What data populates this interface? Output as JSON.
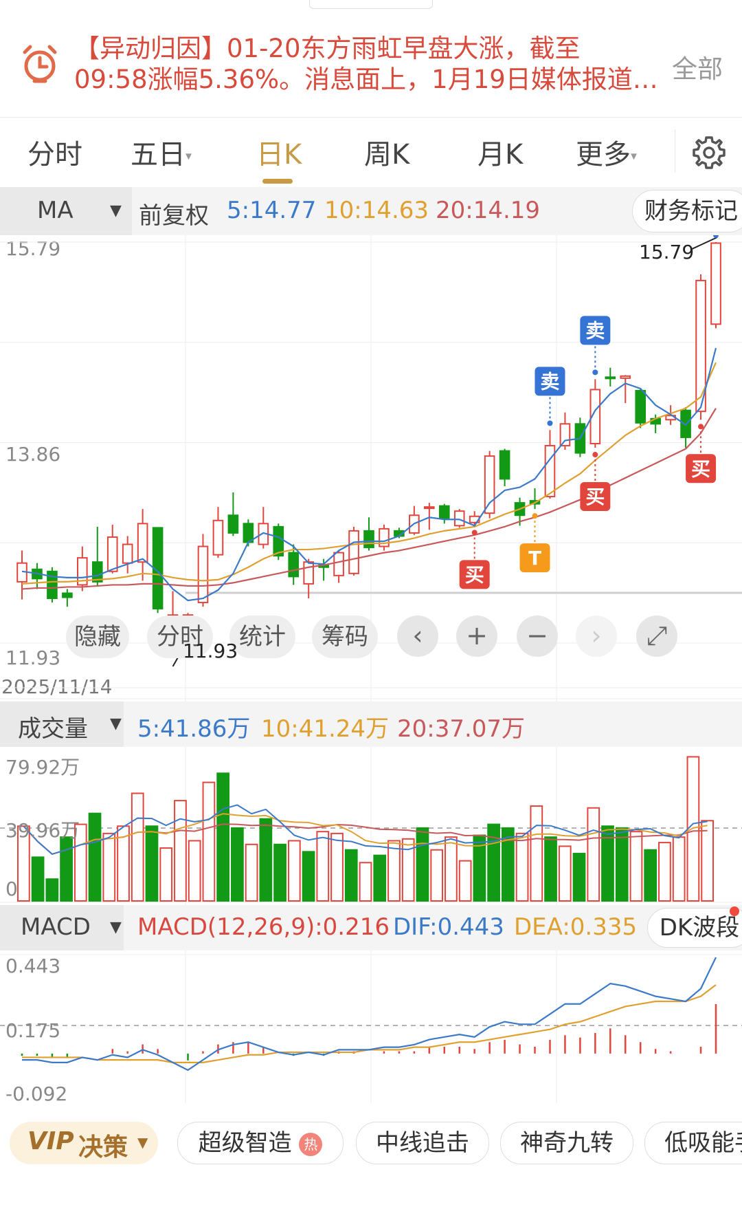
{
  "alert": {
    "line1": "【异动归因】01-20东方雨虹早盘大涨，截至",
    "line2": "09:58涨幅5.36%。消息面上，1月19日媒体报道…",
    "all_label": "全部",
    "icon": "alarm-clock-icon"
  },
  "tabs": [
    "分时",
    "五日",
    "日K",
    "周K",
    "月K",
    "更多"
  ],
  "tab_active": "日K",
  "ma_row": {
    "selector": "MA",
    "adjust": "前复权",
    "ma5": "5:14.77",
    "ma10": "10:14.63",
    "ma20": "20:14.19",
    "finance_btn": "财务标记"
  },
  "price_axis": {
    "top": "15.79",
    "mid": "13.86",
    "bottom": "11.93",
    "date": "2025/11/14"
  },
  "annotations": {
    "high": "15.79",
    "low": "11.93"
  },
  "signals": {
    "sell": "卖",
    "buy": "买",
    "t": "T"
  },
  "chart_controls": {
    "hide": "隐藏",
    "intraday": "分时",
    "stats": "统计",
    "chips": "筹码"
  },
  "volume_row": {
    "selector": "成交量",
    "ma5": "5:41.86万",
    "ma10": "10:41.24万",
    "ma20": "20:37.07万",
    "axis_top": "79.92万",
    "axis_mid": "39.96万",
    "axis_zero": "0"
  },
  "macd_row": {
    "selector": "MACD",
    "macd": "MACD(12,26,9):0.216",
    "dif": "DIF:0.443",
    "dea": "DEA:0.335",
    "dk_btn": "DK波段",
    "axis_top": "0.443",
    "axis_mid": "0.175",
    "axis_bottom": "-0.092"
  },
  "bottom": {
    "vip": "VIP",
    "vip_label": "决策",
    "items": [
      "超级智造",
      "中线追击",
      "神奇九转",
      "低吸能手"
    ],
    "hot_badge": "热"
  },
  "colors": {
    "up": "#e2453c",
    "down": "#129a16",
    "ma5": "#3b79c9",
    "ma10": "#e0a030",
    "ma20": "#c8585a",
    "accent": "#c99a44"
  },
  "chart_data": {
    "type": "candlestick",
    "start_date": "2025/11/14",
    "ylim": [
      11.93,
      15.79
    ],
    "candles": [
      {
        "o": 12.52,
        "c": 12.7,
        "h": 12.82,
        "l": 12.35,
        "up": true
      },
      {
        "o": 12.64,
        "c": 12.55,
        "h": 12.7,
        "l": 12.45,
        "up": false
      },
      {
        "o": 12.62,
        "c": 12.36,
        "h": 12.66,
        "l": 12.32,
        "up": false
      },
      {
        "o": 12.41,
        "c": 12.37,
        "h": 12.45,
        "l": 12.28,
        "up": false
      },
      {
        "o": 12.49,
        "c": 12.75,
        "h": 12.86,
        "l": 12.43,
        "up": true
      },
      {
        "o": 12.71,
        "c": 12.52,
        "h": 13.05,
        "l": 12.48,
        "up": false
      },
      {
        "o": 12.62,
        "c": 12.95,
        "h": 13.07,
        "l": 12.6,
        "up": true
      },
      {
        "o": 12.7,
        "c": 12.88,
        "h": 12.96,
        "l": 12.6,
        "up": true
      },
      {
        "o": 12.71,
        "c": 13.08,
        "h": 13.22,
        "l": 12.53,
        "up": true
      },
      {
        "o": 13.04,
        "c": 12.26,
        "h": 13.04,
        "l": 12.22,
        "up": false
      },
      {
        "o": 12.08,
        "c": 12.2,
        "h": 12.43,
        "l": 11.93,
        "up": true
      },
      {
        "o": 12.1,
        "c": 12.2,
        "h": 12.22,
        "l": 12.08,
        "up": true
      },
      {
        "o": 12.32,
        "c": 12.86,
        "h": 12.98,
        "l": 12.28,
        "up": true
      },
      {
        "o": 12.78,
        "c": 13.11,
        "h": 13.24,
        "l": 12.75,
        "up": true
      },
      {
        "o": 13.16,
        "c": 12.99,
        "h": 13.38,
        "l": 12.96,
        "up": false
      },
      {
        "o": 13.08,
        "c": 12.9,
        "h": 13.12,
        "l": 12.86,
        "up": false
      },
      {
        "o": 12.88,
        "c": 13.08,
        "h": 13.24,
        "l": 12.84,
        "up": true
      },
      {
        "o": 13.05,
        "c": 12.77,
        "h": 13.08,
        "l": 12.73,
        "up": false
      },
      {
        "o": 12.8,
        "c": 12.57,
        "h": 12.88,
        "l": 12.49,
        "up": false
      },
      {
        "o": 12.5,
        "c": 12.71,
        "h": 12.74,
        "l": 12.36,
        "up": true
      },
      {
        "o": 12.66,
        "c": 12.68,
        "h": 12.74,
        "l": 12.53,
        "up": false
      },
      {
        "o": 12.58,
        "c": 12.8,
        "h": 12.82,
        "l": 12.51,
        "up": true
      },
      {
        "o": 12.6,
        "c": 13.01,
        "h": 13.05,
        "l": 12.58,
        "up": true
      },
      {
        "o": 13.01,
        "c": 12.85,
        "h": 13.14,
        "l": 12.82,
        "up": false
      },
      {
        "o": 12.86,
        "c": 13.03,
        "h": 13.07,
        "l": 12.82,
        "up": true
      },
      {
        "o": 13.01,
        "c": 12.96,
        "h": 13.04,
        "l": 12.94,
        "up": false
      },
      {
        "o": 12.99,
        "c": 13.16,
        "h": 13.25,
        "l": 12.97,
        "up": true
      },
      {
        "o": 13.23,
        "c": 13.24,
        "h": 13.28,
        "l": 13.02,
        "up": true
      },
      {
        "o": 13.25,
        "c": 13.13,
        "h": 13.27,
        "l": 13.08,
        "up": false
      },
      {
        "o": 13.06,
        "c": 13.2,
        "h": 13.22,
        "l": 13.04,
        "up": true
      },
      {
        "o": 13.15,
        "c": 13.09,
        "h": 13.2,
        "l": 13.06,
        "up": true
      },
      {
        "o": 13.18,
        "c": 13.73,
        "h": 13.78,
        "l": 13.13,
        "up": true
      },
      {
        "o": 13.78,
        "c": 13.51,
        "h": 13.8,
        "l": 13.44,
        "up": false
      },
      {
        "o": 13.28,
        "c": 13.16,
        "h": 13.33,
        "l": 13.06,
        "up": false
      },
      {
        "o": 13.27,
        "c": 13.3,
        "h": 13.42,
        "l": 13.22,
        "up": false
      },
      {
        "o": 13.34,
        "c": 13.83,
        "h": 13.98,
        "l": 13.32,
        "up": true
      },
      {
        "o": 13.83,
        "c": 14.04,
        "h": 14.15,
        "l": 13.79,
        "up": true
      },
      {
        "o": 14.04,
        "c": 13.76,
        "h": 14.1,
        "l": 13.72,
        "up": false
      },
      {
        "o": 13.85,
        "c": 14.37,
        "h": 14.47,
        "l": 13.81,
        "up": true
      },
      {
        "o": 14.49,
        "c": 14.48,
        "h": 14.58,
        "l": 14.4,
        "up": false
      },
      {
        "o": 14.48,
        "c": 14.5,
        "h": 14.51,
        "l": 14.24,
        "up": true
      },
      {
        "o": 14.36,
        "c": 14.05,
        "h": 14.38,
        "l": 14.0,
        "up": false
      },
      {
        "o": 14.09,
        "c": 14.04,
        "h": 14.13,
        "l": 13.95,
        "up": false
      },
      {
        "o": 14.08,
        "c": 14.12,
        "h": 14.22,
        "l": 14.03,
        "up": true
      },
      {
        "o": 14.17,
        "c": 13.91,
        "h": 14.2,
        "l": 13.81,
        "up": false
      },
      {
        "o": 14.16,
        "c": 15.42,
        "h": 15.48,
        "l": 14.08,
        "up": true
      },
      {
        "o": 15.0,
        "c": 15.78,
        "h": 15.79,
        "l": 14.96,
        "up": true
      }
    ],
    "ma5": [
      12.62,
      12.6,
      12.57,
      12.56,
      12.56,
      12.58,
      12.64,
      12.69,
      12.74,
      12.62,
      12.45,
      12.34,
      12.36,
      12.44,
      12.6,
      12.9,
      12.99,
      12.95,
      12.86,
      12.7,
      12.69,
      12.82,
      12.9,
      12.91,
      12.91,
      12.96,
      13.08,
      13.14,
      13.12,
      13.12,
      13.06,
      13.28,
      13.4,
      13.43,
      13.51,
      13.7,
      13.88,
      13.9,
      14.17,
      14.33,
      14.43,
      14.38,
      14.22,
      14.13,
      14.03,
      14.2,
      14.77
    ],
    "ma10": [
      12.5,
      12.51,
      12.52,
      12.52,
      12.53,
      12.54,
      12.55,
      12.57,
      12.6,
      12.59,
      12.56,
      12.54,
      12.53,
      12.54,
      12.59,
      12.66,
      12.74,
      12.8,
      12.83,
      12.83,
      12.84,
      12.86,
      12.88,
      12.89,
      12.89,
      12.91,
      12.94,
      12.98,
      13.01,
      13.03,
      13.05,
      13.11,
      13.17,
      13.22,
      13.28,
      13.37,
      13.47,
      13.56,
      13.69,
      13.81,
      13.93,
      14.02,
      14.09,
      14.14,
      14.19,
      14.3,
      14.63
    ],
    "ma20": [
      12.45,
      12.46,
      12.46,
      12.47,
      12.47,
      12.48,
      12.49,
      12.49,
      12.5,
      12.5,
      12.49,
      12.48,
      12.48,
      12.49,
      12.51,
      12.54,
      12.57,
      12.6,
      12.63,
      12.66,
      12.68,
      12.71,
      12.74,
      12.77,
      12.8,
      12.82,
      12.85,
      12.88,
      12.91,
      12.94,
      12.97,
      13.01,
      13.05,
      13.1,
      13.14,
      13.19,
      13.25,
      13.31,
      13.38,
      13.45,
      13.52,
      13.59,
      13.66,
      13.73,
      13.8,
      13.95,
      14.19
    ],
    "signal_points": [
      {
        "i": 30,
        "type": "buy"
      },
      {
        "i": 34,
        "type": "t"
      },
      {
        "i": 35,
        "type": "sell"
      },
      {
        "i": 38,
        "type": "buy"
      },
      {
        "i": 38,
        "type": "sell"
      },
      {
        "i": 45,
        "type": "buy"
      },
      {
        "i": 46,
        "type": "sell"
      }
    ],
    "volume_ylim": [
      0,
      79.92
    ],
    "volume": [
      41,
      24,
      12,
      35,
      42,
      48,
      37,
      41,
      59,
      41,
      29,
      55,
      33,
      65,
      70,
      40,
      31,
      45,
      31,
      33,
      27,
      38,
      37,
      28,
      21,
      25,
      33,
      34,
      40,
      28,
      35,
      22,
      36,
      42,
      40,
      37,
      52,
      35,
      30,
      26,
      51,
      41,
      40,
      38,
      28,
      32,
      35,
      79,
      44
    ],
    "macd_ylim": [
      -0.092,
      0.443
    ],
    "dif": [
      0.04,
      0.04,
      0.03,
      0.03,
      0.05,
      0.04,
      0.06,
      0.05,
      0.08,
      0.06,
      0.03,
      0.0,
      0.04,
      0.08,
      0.1,
      0.11,
      0.09,
      0.07,
      0.06,
      0.07,
      0.06,
      0.08,
      0.08,
      0.08,
      0.09,
      0.09,
      0.1,
      0.12,
      0.13,
      0.14,
      0.13,
      0.17,
      0.19,
      0.18,
      0.18,
      0.22,
      0.26,
      0.26,
      0.3,
      0.34,
      0.33,
      0.31,
      0.29,
      0.28,
      0.27,
      0.32,
      0.443
    ],
    "dea": [
      0.05,
      0.05,
      0.05,
      0.05,
      0.05,
      0.04,
      0.04,
      0.04,
      0.04,
      0.04,
      0.03,
      0.03,
      0.03,
      0.04,
      0.05,
      0.06,
      0.06,
      0.07,
      0.07,
      0.07,
      0.07,
      0.07,
      0.07,
      0.08,
      0.08,
      0.08,
      0.09,
      0.09,
      0.1,
      0.11,
      0.11,
      0.12,
      0.13,
      0.14,
      0.15,
      0.16,
      0.18,
      0.19,
      0.21,
      0.23,
      0.25,
      0.26,
      0.27,
      0.27,
      0.27,
      0.29,
      0.335
    ],
    "macd_hist": [
      -0.01,
      -0.01,
      -0.02,
      -0.02,
      0.0,
      0.0,
      0.02,
      0.01,
      0.04,
      0.02,
      0.0,
      -0.03,
      0.01,
      0.04,
      0.05,
      0.05,
      0.03,
      0.0,
      -0.01,
      0.0,
      -0.01,
      0.01,
      0.01,
      0.0,
      0.01,
      0.01,
      0.01,
      0.03,
      0.03,
      0.03,
      0.02,
      0.05,
      0.06,
      0.04,
      0.03,
      0.06,
      0.08,
      0.07,
      0.09,
      0.11,
      0.08,
      0.05,
      0.02,
      0.01,
      0.0,
      0.03,
      0.216
    ]
  }
}
